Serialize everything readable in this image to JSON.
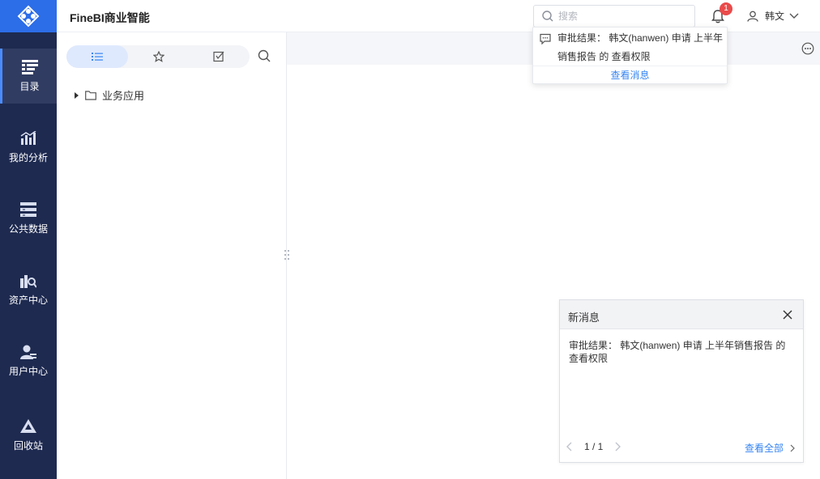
{
  "app": {
    "title": "FineBI商业智能"
  },
  "rail": {
    "items": [
      {
        "label": "目录",
        "icon": "catalog-icon",
        "active": true
      },
      {
        "label": "我的分析",
        "icon": "analysis-chart-icon"
      },
      {
        "label": "公共数据",
        "icon": "database-icon"
      },
      {
        "label": "资产中心",
        "icon": "asset-search-icon"
      },
      {
        "label": "用户中心",
        "icon": "user-settings-icon"
      },
      {
        "label": "回收站",
        "icon": "recycle-icon"
      }
    ]
  },
  "header": {
    "search_placeholder": "搜索",
    "notification_count": "1",
    "user_name": "韩文"
  },
  "dropdown": {
    "message": "审批结果： 韩文(hanwen) 申请 上半年销售报告 的 查看权限",
    "view_messages": "查看消息"
  },
  "panel": {
    "tabs": [
      "list-icon",
      "star-icon",
      "checkbox-icon"
    ],
    "tree": [
      {
        "label": "业务应用",
        "icon": "folder-icon"
      }
    ]
  },
  "popup": {
    "title": "新消息",
    "message": "审批结果： 韩文(hanwen) 申请 上半年销售报告 的 查看权限",
    "page": "1 / 1",
    "view_all": "查看全部"
  },
  "colors": {
    "rail_bg": "#1e2a50",
    "accent": "#2c6de8",
    "link": "#3685f2",
    "badge": "#ea4a4a"
  }
}
